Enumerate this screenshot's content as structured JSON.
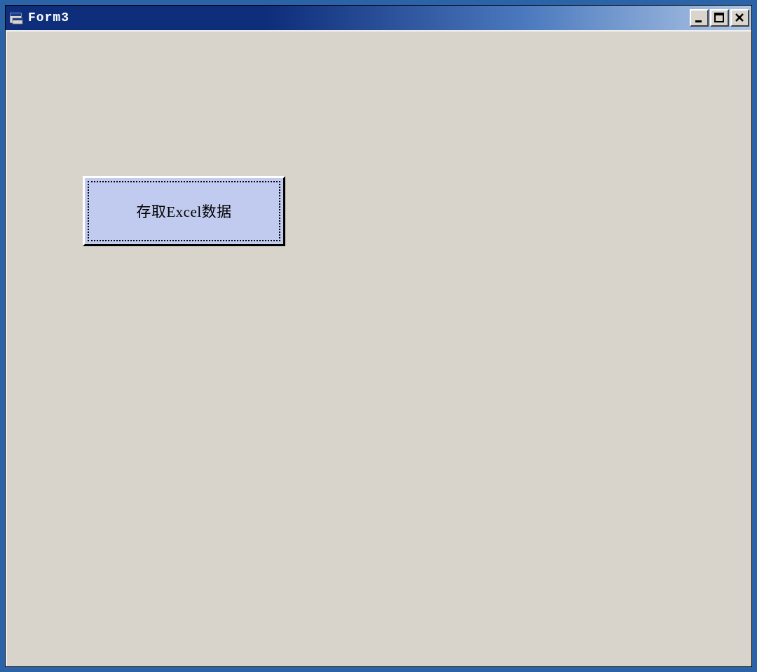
{
  "window": {
    "title": "Form3"
  },
  "main_button": {
    "label": "存取Excel数据"
  }
}
